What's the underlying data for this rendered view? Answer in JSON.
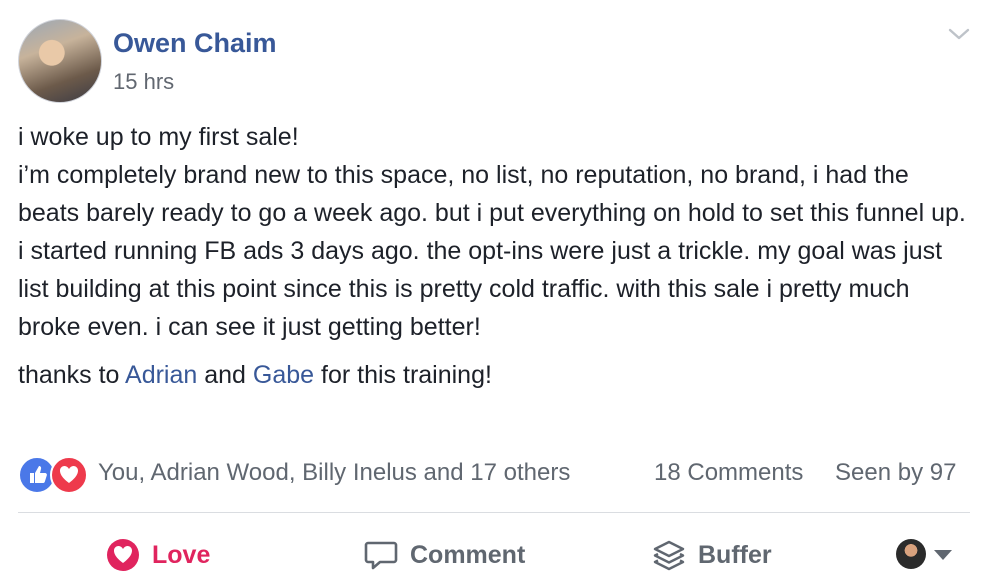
{
  "post": {
    "author": "Owen Chaim",
    "time": "15 hrs",
    "paragraph1": "i woke up to my first sale!\ni’m completely brand new to this space, no list, no reputation, no brand, i had the beats barely ready to go a week ago. but i put everything on hold to set this funnel up. i started running FB ads 3 days ago. the opt-ins were just a trickle. my goal was just list building at this point since this is pretty cold traffic. with this sale i pretty much broke even. i can see it just getting better!",
    "p2_prefix": "thanks to ",
    "p2_mention1": "Adrian",
    "p2_mid": " and ",
    "p2_mention2": "Gabe",
    "p2_suffix": " for this training!"
  },
  "stats": {
    "reactions_text": "You, Adrian Wood, Billy Inelus and 17 others",
    "comments_text": "18 Comments",
    "seen_text": "Seen by 97"
  },
  "actions": {
    "love": "Love",
    "comment": "Comment",
    "buffer": "Buffer"
  },
  "colors": {
    "link": "#385898",
    "love": "#e0245e",
    "like_badge": "#4a78e8",
    "love_badge": "#ee3a4c"
  },
  "icons": [
    "chevron-down-icon",
    "like-reaction-icon",
    "love-reaction-icon",
    "heart-icon",
    "comment-icon",
    "buffer-icon",
    "caret-down-icon"
  ]
}
